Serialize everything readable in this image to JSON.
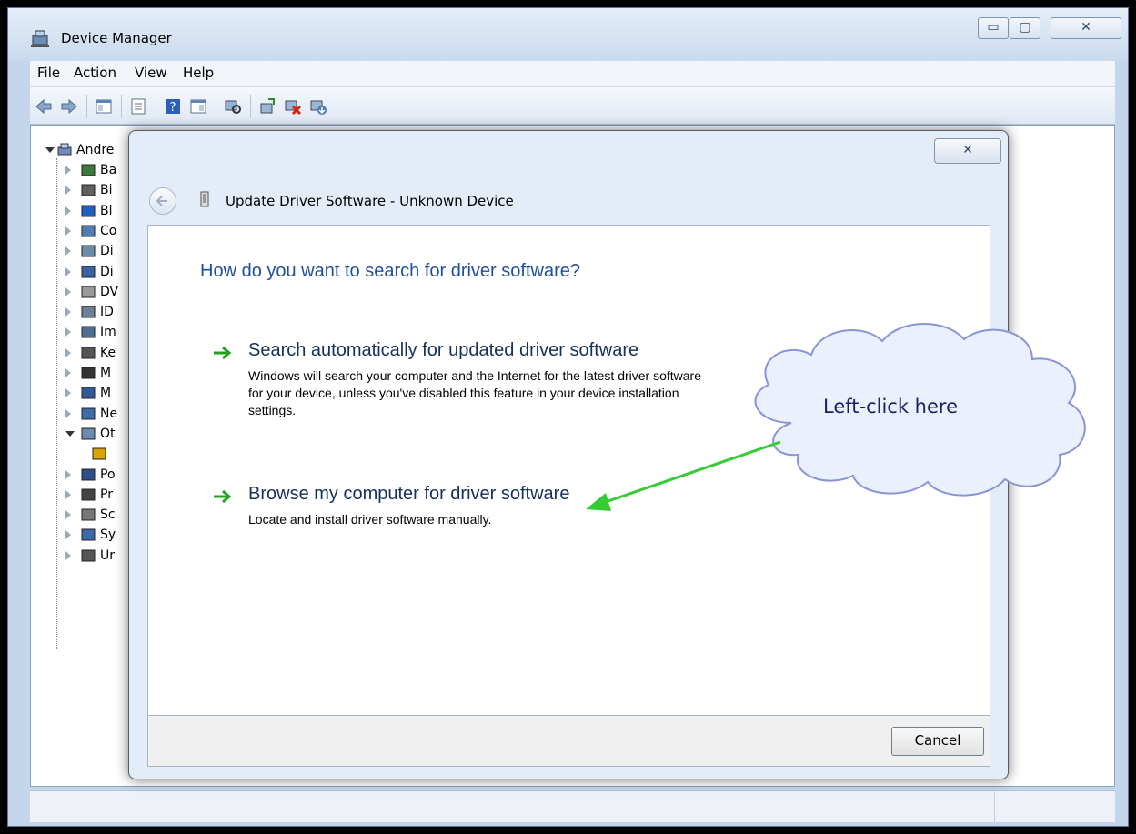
{
  "window": {
    "title": "Device Manager",
    "minimize_glyph": "▭",
    "maximize_glyph": "▢",
    "close_glyph": "✕"
  },
  "menu": [
    "File",
    "Action",
    "View",
    "Help"
  ],
  "tree": {
    "root_label": "Andre",
    "items": [
      "Ba",
      "Bi",
      "Bl",
      "Co",
      "Di",
      "Di",
      "DV",
      "ID",
      "Im",
      "Ke",
      "M",
      "M",
      "Ne",
      "Ot",
      "",
      "Po",
      "Pr",
      "Sc",
      "Sy",
      "Ur"
    ]
  },
  "dialog": {
    "title": "Update Driver Software - Unknown Device",
    "close_glyph": "✕",
    "heading": "How do you want to search for driver software?",
    "option_auto": {
      "title": "Search automatically for updated driver software",
      "desc_line1": "Windows will search your computer and the Internet for the latest driver software",
      "desc_line2": "for your device, unless you've disabled this feature in your device installation",
      "desc_line3": "settings."
    },
    "option_browse": {
      "title": "Browse my computer for driver software",
      "desc": "Locate and install driver software manually."
    },
    "cancel_label": "Cancel"
  },
  "callout": {
    "text": "Left-click here"
  },
  "colors": {
    "accent": "#1e4f9e",
    "arrow_green": "#33cc33",
    "cloud_stroke": "#8a93d6"
  }
}
